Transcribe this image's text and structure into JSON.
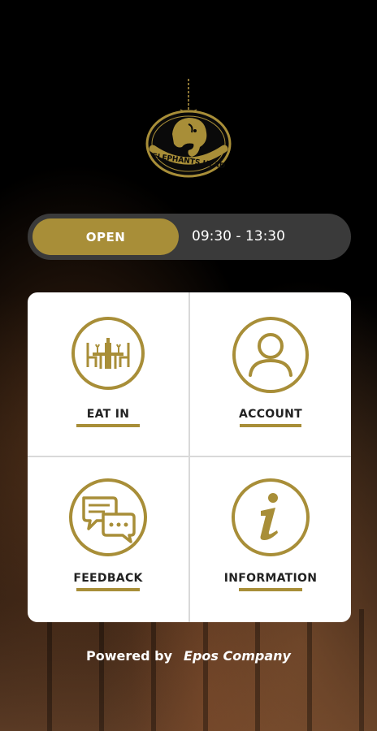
{
  "brand": {
    "name": "ELEPHANTS HEAD",
    "accent": "#a88e38",
    "logo_icon": "elephant-head-sign-icon"
  },
  "status": {
    "state_label": "OPEN",
    "hours": "09:30 - 13:30"
  },
  "menu": {
    "eat_in": {
      "label": "EAT IN",
      "icon": "dining-table-icon"
    },
    "account": {
      "label": "ACCOUNT",
      "icon": "user-icon"
    },
    "feedback": {
      "label": "FEEDBACK",
      "icon": "chat-bubbles-icon"
    },
    "information": {
      "label": "INFORMATION",
      "icon": "info-icon"
    }
  },
  "footer": {
    "prefix": "Powered by",
    "company": "Epos Company"
  }
}
